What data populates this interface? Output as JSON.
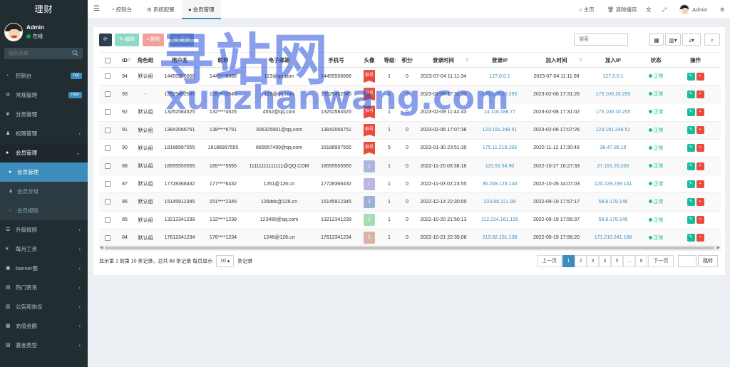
{
  "app": {
    "title": "理财"
  },
  "user": {
    "name": "Admin",
    "status": "在线"
  },
  "sidebar": {
    "search_placeholder": "搜索菜单",
    "items": [
      {
        "label": "控制台",
        "badge": "hot",
        "badge_color": "#3c8dbc"
      },
      {
        "label": "常规管理",
        "badge": "new",
        "badge_color": "#3c8dbc"
      },
      {
        "label": "分类管理"
      },
      {
        "label": "权限管理"
      },
      {
        "label": "会员管理"
      },
      {
        "label": "会员管理"
      },
      {
        "label": "会员分组"
      },
      {
        "label": "会员规则"
      },
      {
        "label": "升级规则"
      },
      {
        "label": "每月工资"
      },
      {
        "label": "banner图"
      },
      {
        "label": "热门资讯"
      },
      {
        "label": "公告和协议"
      },
      {
        "label": "充值金额"
      },
      {
        "label": "基金类型"
      }
    ]
  },
  "navbar": {
    "tabs": [
      "控制台",
      "系统配置",
      "会员管理"
    ],
    "home": "主页",
    "clear_cache": "清除缓存",
    "user": "Admin"
  },
  "toolbar": {
    "edit": "编辑",
    "delete": "删除",
    "more": "更多",
    "search_placeholder": "搜索"
  },
  "table": {
    "headers": [
      "ID",
      "角色组",
      "用户名",
      "昵称",
      "电子邮箱",
      "手机号",
      "头像",
      "等级",
      "积分",
      "登录时间",
      "登录IP",
      "加入时间",
      "加入IP",
      "状态",
      "操作"
    ],
    "status_text": "正常",
    "rows": [
      {
        "id": "94",
        "group": "默认组",
        "username": "14455556666",
        "nickname": "144****6666",
        "email": "123@qq.com",
        "mobile": "14455556666",
        "avatar": {
          "type": "tag",
          "text": "推号"
        },
        "level": "1",
        "score": "0",
        "login_time": "2023-07-04 11:11:34",
        "login_ip": "127.0.0.1",
        "join_time": "2023-07-04 11:11:08",
        "join_ip": "127.0.0.1"
      },
      {
        "id": "93",
        "group": "-",
        "username": "13525452545",
        "nickname": "135****2545",
        "email": "123@qq.com",
        "mobile": "13525452545",
        "avatar": {
          "type": "tag",
          "text": "推号"
        },
        "level": "1",
        "score": "0",
        "login_time": "2023-02-08 17:31:33",
        "login_ip": "175.100.10.255",
        "join_time": "2023-02-08 17:31:26",
        "join_ip": "175.100.10.255"
      },
      {
        "id": "92",
        "group": "默认组",
        "username": "13252584525",
        "nickname": "132****4525",
        "email": "4552@qq.com",
        "mobile": "13252584525",
        "avatar": {
          "type": "tag",
          "text": "推号"
        },
        "level": "1",
        "score": "0",
        "login_time": "2023-02-09 11:42:43",
        "login_ip": "14.116.188.77",
        "join_time": "2023-02-08 17:31:02",
        "join_ip": "175.100.10.255"
      },
      {
        "id": "91",
        "group": "默认组",
        "username": "13842066751",
        "nickname": "138****6751",
        "email": "306325901@qq.com",
        "mobile": "13842066751",
        "avatar": {
          "type": "tag",
          "text": "推号"
        },
        "level": "1",
        "score": "0",
        "login_time": "2023-02-06 17:07:38",
        "login_ip": "123.191.248.51",
        "join_time": "2023-02-06 17:07:26",
        "join_ip": "123.191.248.51"
      },
      {
        "id": "90",
        "group": "默认组",
        "username": "18188997555",
        "nickname": "18188997555",
        "email": "865657499@qq.com",
        "mobile": "18188997555",
        "avatar": {
          "type": "tag",
          "text": "推号"
        },
        "level": "5",
        "score": "0",
        "login_time": "2023-01-30 23:51:30",
        "login_ip": "175.11.219.193",
        "join_time": "2022-11-12 17:30:49",
        "join_ip": "36.47.95.18"
      },
      {
        "id": "88",
        "group": "默认组",
        "username": "18555555555",
        "nickname": "185****5555",
        "email": "11111111111111@QQ.COM",
        "mobile": "18555555555",
        "avatar": {
          "type": "num",
          "text": "1",
          "color": "#a9b8d9"
        },
        "level": "1",
        "score": "0",
        "login_time": "2022-11-20 03:38:18",
        "login_ip": "115.53.54.90",
        "join_time": "2022-10-27 16:27:33",
        "join_ip": "27.191.25.200"
      },
      {
        "id": "87",
        "group": "默认组",
        "username": "17728366432",
        "nickname": "177****6432",
        "email": "1261@126.cn",
        "mobile": "17728366432",
        "avatar": {
          "type": "num",
          "text": "1",
          "color": "#b8b8e0"
        },
        "level": "1",
        "score": "0",
        "login_time": "2022-11-03 02:23:55",
        "login_ip": "36.249.123.140",
        "join_time": "2022-10-26 14:07:03",
        "join_ip": "120.229.239.141"
      },
      {
        "id": "86",
        "group": "默认组",
        "username": "15145912345",
        "nickname": "151****2345",
        "email": "126ddc@126.cn",
        "mobile": "15145912345",
        "avatar": {
          "type": "num",
          "text": "1",
          "color": "#9fb0d8"
        },
        "level": "1",
        "score": "0",
        "login_time": "2022-12-14 22:30:00",
        "login_ip": "223.88.121.88",
        "join_time": "2022-09-19 17:57:17",
        "join_ip": "58.8.178.146"
      },
      {
        "id": "85",
        "group": "默认组",
        "username": "13212341239",
        "nickname": "132****1239",
        "email": "123456@qq.com",
        "mobile": "13212341239",
        "avatar": {
          "type": "num",
          "text": "1",
          "color": "#a8dcb4"
        },
        "level": "1",
        "score": "0",
        "login_time": "2022-10-20 21:50:13",
        "login_ip": "112.224.161.195",
        "join_time": "2022-09-19 17:56:37",
        "join_ip": "58.8.178.146"
      },
      {
        "id": "84",
        "group": "默认组",
        "username": "17612341234",
        "nickname": "176****1234",
        "email": "1246@126.cn",
        "mobile": "17612341234",
        "avatar": {
          "type": "num",
          "text": "1",
          "color": "#d9b3a6"
        },
        "level": "1",
        "score": "0",
        "login_time": "2022-10-21 22:35:08",
        "login_ip": "219.92.151.138",
        "join_time": "2022-09-19 17:56:20",
        "join_ip": "171.210.241.168"
      }
    ]
  },
  "footer": {
    "info_prefix": "显示第 1 到第 10 条记录，总共 89 条记录 每页显示",
    "page_size": "10",
    "info_suffix": "条记录"
  },
  "pagination": {
    "prev": "上一页",
    "pages": [
      "1",
      "2",
      "3",
      "4",
      "5",
      "...",
      "9"
    ],
    "next": "下一页",
    "jump": "跳转"
  },
  "watermark": {
    "line1": "寻站网",
    "line2": "xunzhanwang.com"
  }
}
